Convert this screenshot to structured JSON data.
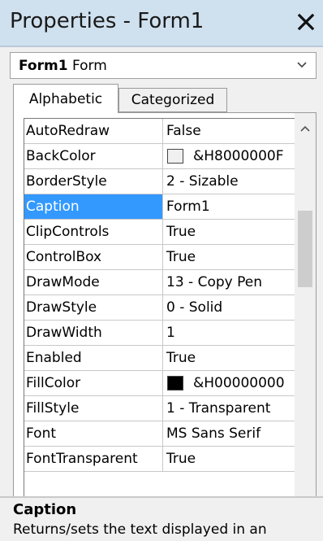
{
  "window": {
    "title": "Properties - Form1",
    "close_icon": "close-icon"
  },
  "object_selector": {
    "name": "Form1",
    "type": "Form",
    "icon": "chevron-down-icon"
  },
  "tabs": [
    {
      "label": "Alphabetic",
      "active": true
    },
    {
      "label": "Categorized",
      "active": false
    }
  ],
  "properties": [
    {
      "name": "AutoRedraw",
      "value": "False"
    },
    {
      "name": "BackColor",
      "value": "&H8000000F",
      "swatch": "#f0f0f0"
    },
    {
      "name": "BorderStyle",
      "value": "2 - Sizable"
    },
    {
      "name": "Caption",
      "value": "Form1",
      "selected": true
    },
    {
      "name": "ClipControls",
      "value": "True"
    },
    {
      "name": "ControlBox",
      "value": "True"
    },
    {
      "name": "DrawMode",
      "value": "13 - Copy Pen"
    },
    {
      "name": "DrawStyle",
      "value": "0 - Solid"
    },
    {
      "name": "DrawWidth",
      "value": "1"
    },
    {
      "name": "Enabled",
      "value": "True"
    },
    {
      "name": "FillColor",
      "value": "&H00000000",
      "swatch": "#000000"
    },
    {
      "name": "FillStyle",
      "value": "1 - Transparent"
    },
    {
      "name": "Font",
      "value": "MS Sans Serif"
    },
    {
      "name": "FontTransparent",
      "value": "True"
    }
  ],
  "scrollbar": {
    "up_icon": "scroll-up-arrow-icon",
    "down_icon": "scroll-down-arrow-icon"
  },
  "description": {
    "title": "Caption",
    "text": "Returns/sets the text displayed in an"
  },
  "colors": {
    "titlebar": "#cfe0ef",
    "selection": "#3399ff"
  }
}
